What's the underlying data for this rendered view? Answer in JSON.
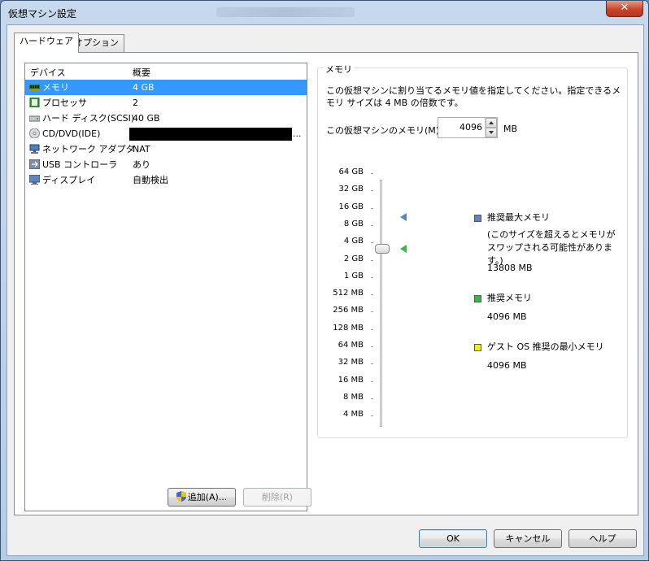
{
  "window": {
    "title": "仮想マシン設定"
  },
  "tabs": [
    {
      "label": "ハードウェア"
    },
    {
      "label": "オプション"
    }
  ],
  "device_list": {
    "headers": {
      "device": "デバイス",
      "summary": "概要"
    },
    "rows": [
      {
        "icon": "memory-icon",
        "name": "メモリ",
        "summary": "4 GB"
      },
      {
        "icon": "processor-icon",
        "name": "プロセッサ",
        "summary": "2"
      },
      {
        "icon": "hard-disk-icon",
        "name": "ハード ディスク(SCSI)",
        "summary": "40 GB"
      },
      {
        "icon": "cd-dvd-icon",
        "name": "CD/DVD(IDE)",
        "summary": "..."
      },
      {
        "icon": "network-adapter-icon",
        "name": "ネットワーク アダプタ",
        "summary": "NAT"
      },
      {
        "icon": "usb-icon",
        "name": "USB コントローラ",
        "summary": "あり"
      },
      {
        "icon": "display-icon",
        "name": "ディスプレイ",
        "summary": "自動検出"
      }
    ]
  },
  "buttons": {
    "add": "追加(A)...",
    "remove": "削除(R)",
    "ok": "OK",
    "cancel": "キャンセル",
    "help": "ヘルプ"
  },
  "memory": {
    "group_title": "メモリ",
    "description": "この仮想マシンに割り当てるメモリ値を指定してください。指定できるメモリ サイズは 4 MB の倍数です。",
    "field_label": "この仮想マシンのメモリ(M):",
    "value": "4096",
    "unit": "MB",
    "scale": [
      "64 GB",
      "32 GB",
      "16 GB",
      "8 GB",
      "4 GB",
      "2 GB",
      "1 GB",
      "512 MB",
      "256 MB",
      "128 MB",
      "64 MB",
      "32 MB",
      "16 MB",
      "8 MB",
      "4 MB"
    ],
    "legend": {
      "max": {
        "title": "推奨最大メモリ",
        "note": "(このサイズを超えるとメモリがスワップされる可能性があります。)",
        "value": "13808 MB",
        "color": "#5b83c6"
      },
      "recommended": {
        "title": "推奨メモリ",
        "value": "4096 MB",
        "color": "#39b54a"
      },
      "guest_min": {
        "title": "ゲスト OS 推奨の最小メモリ",
        "value": "4096 MB",
        "color": "#f2f200"
      }
    }
  }
}
